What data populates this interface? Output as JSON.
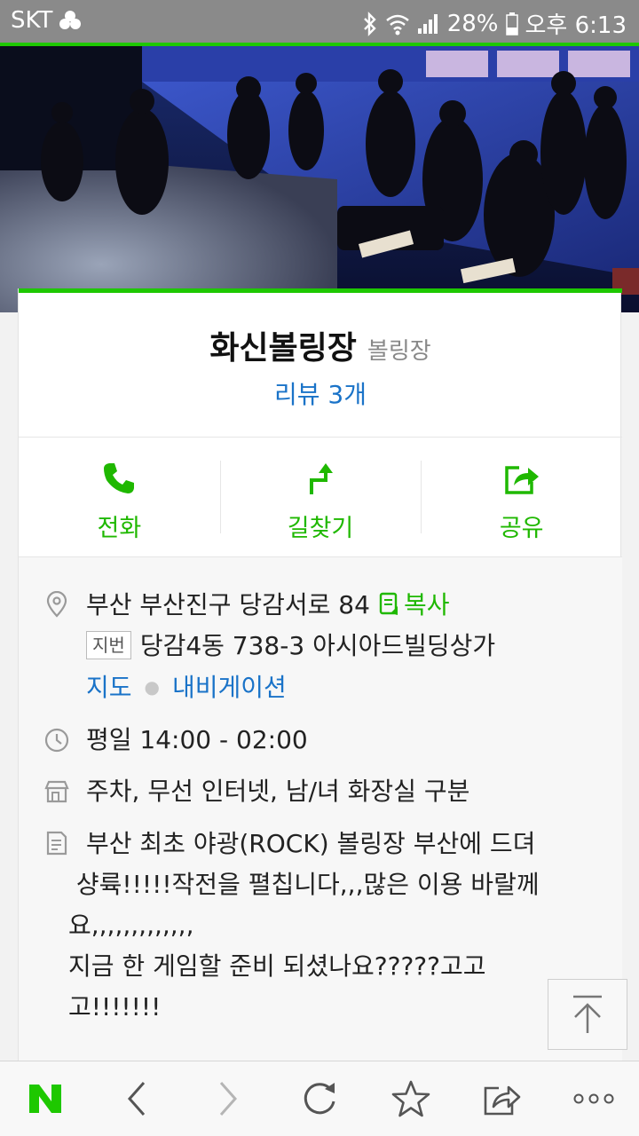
{
  "status_bar": {
    "carrier": "SKT",
    "battery": "28%",
    "time": "오후 6:13"
  },
  "place": {
    "name": "화신볼링장",
    "category": "볼링장",
    "review_label": "리뷰 3개"
  },
  "actions": [
    {
      "label": "전화",
      "icon": "phone-icon"
    },
    {
      "label": "길찾기",
      "icon": "directions-icon"
    },
    {
      "label": "공유",
      "icon": "share-icon"
    }
  ],
  "info": {
    "address": "부산 부산진구 당감서로 84",
    "copy_label": "복사",
    "jibun_badge": "지번",
    "jibun_address": "당감4동 738-3 아시아드빌딩상가",
    "map_link": "지도",
    "navigation_link": "내비게이션",
    "hours": "평일 14:00 - 02:00",
    "facilities": "주차, 무선 인터넷, 남/녀 화장실 구분",
    "description_lines": [
      "부산 최초 야광(ROCK) 볼링장  부산에 드뎌",
      " 샹륙!!!!!작전을 펼칩니다,,,많은 이용 바랄께",
      "요,,,,,,,,,,,,,",
      "지금 한 게임할 준비 되셨나요?????고고",
      "고!!!!!!!"
    ]
  },
  "colors": {
    "accent_green": "#1ec800",
    "link_blue": "#1a73c8"
  },
  "bottom_nav": [
    "naver-logo",
    "back-icon",
    "forward-icon",
    "refresh-icon",
    "bookmark-star-icon",
    "share-icon",
    "more-icon"
  ]
}
